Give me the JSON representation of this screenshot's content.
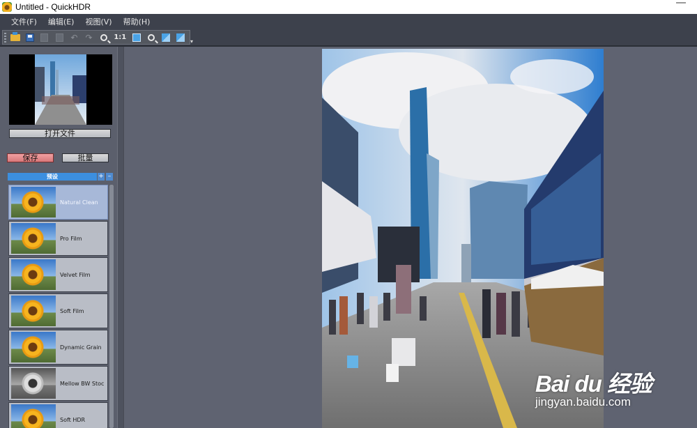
{
  "window": {
    "title": "Untitled - QuickHDR"
  },
  "menu": [
    "文件(F)",
    "编辑(E)",
    "视图(V)",
    "帮助(H)"
  ],
  "toolbar": {
    "buttons": [
      "open-icon",
      "save-icon",
      "copy-icon",
      "paste-icon",
      "undo-icon",
      "redo-icon",
      "zoom-in-icon",
      "zoom-actual-icon",
      "fit-icon",
      "zoom-out-icon",
      "rotate-left-icon",
      "rotate-right-icon"
    ],
    "actual_size_label": "1:1"
  },
  "sidebar": {
    "open_file_label": "打开文件",
    "save_label": "保存",
    "batch_label": "批量",
    "presets_header": "预设",
    "add_label": "+",
    "remove_label": "–",
    "presets": [
      {
        "name": "Natural Clean",
        "selected": true
      },
      {
        "name": "Pro Film",
        "selected": false
      },
      {
        "name": "Velvet Film",
        "selected": false
      },
      {
        "name": "Soft Film",
        "selected": false
      },
      {
        "name": "Dynamic Grain",
        "selected": false
      },
      {
        "name": "Mellow BW Stoc",
        "selected": false
      },
      {
        "name": "Soft HDR",
        "selected": false
      }
    ]
  },
  "watermark": {
    "brand": "Bai du 经验",
    "sub": "jingyan.baidu.com"
  },
  "colors": {
    "accent": "#3c8fdf",
    "panel": "#5b5f6c",
    "save_button": "#e5898b"
  }
}
